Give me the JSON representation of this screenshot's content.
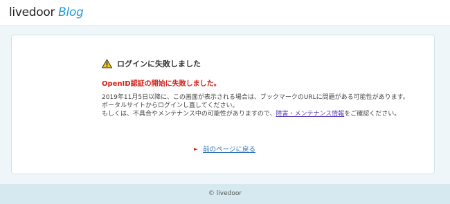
{
  "header": {
    "logo_main": "livedoor",
    "logo_sub": "Blog"
  },
  "error": {
    "title": "ログインに失敗しました",
    "message": "OpenID認証の開始に失敗しました。",
    "desc_line1": "2019年11月5日以降に、この画面が表示される場合は、ブックマークのURLに問題がある可能性があります。",
    "desc_line2": "ポータルサイトからログインし直してください。",
    "desc_line3_before": "もしくは、不具合やメンテナンス中の可能性がありますので、",
    "desc_link": "障害・メンテナンス情報",
    "desc_line3_after": "をご確認ください。",
    "back_link": "前のページに戻る"
  },
  "footer": {
    "copyright": "© livedoor"
  },
  "colors": {
    "brand_blue": "#1e9bd7",
    "error_red": "#d4211a",
    "link_blue": "#2a6fb0",
    "visited_link": "#5b3fb8"
  }
}
